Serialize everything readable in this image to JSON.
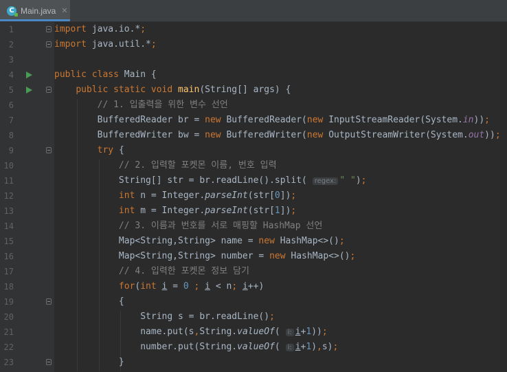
{
  "tab": {
    "filename": "Main.java",
    "icon": "java-class-icon",
    "close": "✕"
  },
  "lines": [
    {
      "n": "1",
      "run": false,
      "fold": true,
      "code": [
        {
          "k": "kw",
          "t": "import"
        },
        {
          "t": " java.io.*"
        },
        {
          "k": "kw",
          "t": ";"
        }
      ]
    },
    {
      "n": "2",
      "run": false,
      "fold": true,
      "code": [
        {
          "k": "kw",
          "t": "import"
        },
        {
          "t": " java.util.*"
        },
        {
          "k": "kw",
          "t": ";"
        }
      ]
    },
    {
      "n": "3",
      "run": false,
      "fold": false,
      "code": []
    },
    {
      "n": "4",
      "run": true,
      "fold": false,
      "code": [
        {
          "k": "kw",
          "t": "public class "
        },
        {
          "t": "Main {"
        }
      ]
    },
    {
      "n": "5",
      "run": true,
      "fold": true,
      "code": [
        {
          "t": "    "
        },
        {
          "k": "kw",
          "t": "public static void "
        },
        {
          "k": "fn",
          "t": "main"
        },
        {
          "t": "(String[] args) {"
        }
      ]
    },
    {
      "n": "6",
      "run": false,
      "fold": false,
      "code": [
        {
          "t": "        "
        },
        {
          "k": "cm",
          "t": "// 1. 입출력을 위한 변수 선언"
        }
      ]
    },
    {
      "n": "7",
      "run": false,
      "fold": false,
      "code": [
        {
          "t": "        BufferedReader br = "
        },
        {
          "k": "kw",
          "t": "new "
        },
        {
          "t": "BufferedReader("
        },
        {
          "k": "kw",
          "t": "new "
        },
        {
          "t": "InputStreamReader(System."
        },
        {
          "k": "fld",
          "t": "in"
        },
        {
          "t": "))"
        },
        {
          "k": "kw",
          "t": ";"
        }
      ]
    },
    {
      "n": "8",
      "run": false,
      "fold": false,
      "code": [
        {
          "t": "        BufferedWriter bw = "
        },
        {
          "k": "kw",
          "t": "new "
        },
        {
          "t": "BufferedWriter("
        },
        {
          "k": "kw",
          "t": "new "
        },
        {
          "t": "OutputStreamWriter(System."
        },
        {
          "k": "fld",
          "t": "out"
        },
        {
          "t": "))"
        },
        {
          "k": "kw",
          "t": ";"
        }
      ]
    },
    {
      "n": "9",
      "run": false,
      "fold": true,
      "code": [
        {
          "t": "        "
        },
        {
          "k": "kw",
          "t": "try "
        },
        {
          "t": "{"
        }
      ]
    },
    {
      "n": "10",
      "run": false,
      "fold": false,
      "code": [
        {
          "t": "            "
        },
        {
          "k": "cm",
          "t": "// 2. 입력할 포켓몬 이름, 번호 입력"
        }
      ]
    },
    {
      "n": "11",
      "run": false,
      "fold": false,
      "code": [
        {
          "t": "            String[] str = br.readLine().split( "
        },
        {
          "k": "hint",
          "t": "regex:"
        },
        {
          "k": "st",
          "t": "\" \""
        },
        {
          "t": ")"
        },
        {
          "k": "kw",
          "t": ";"
        }
      ]
    },
    {
      "n": "12",
      "run": false,
      "fold": false,
      "code": [
        {
          "t": "            "
        },
        {
          "k": "kw",
          "t": "int "
        },
        {
          "t": "n = Integer."
        },
        {
          "k": "it",
          "t": "parseInt"
        },
        {
          "t": "(str["
        },
        {
          "k": "num",
          "t": "0"
        },
        {
          "t": "])"
        },
        {
          "k": "kw",
          "t": ";"
        }
      ]
    },
    {
      "n": "13",
      "run": false,
      "fold": false,
      "code": [
        {
          "t": "            "
        },
        {
          "k": "kw",
          "t": "int "
        },
        {
          "t": "m = Integer."
        },
        {
          "k": "it",
          "t": "parseInt"
        },
        {
          "t": "(str["
        },
        {
          "k": "num",
          "t": "1"
        },
        {
          "t": "])"
        },
        {
          "k": "kw",
          "t": ";"
        }
      ]
    },
    {
      "n": "14",
      "run": false,
      "fold": false,
      "code": [
        {
          "t": "            "
        },
        {
          "k": "cm",
          "t": "// 3. 이름과 번호를 서로 매핑할 HashMap 선언"
        }
      ]
    },
    {
      "n": "15",
      "run": false,
      "fold": false,
      "code": [
        {
          "t": "            Map<String,String> name = "
        },
        {
          "k": "kw",
          "t": "new "
        },
        {
          "t": "HashMap<>()"
        },
        {
          "k": "kw",
          "t": ";"
        }
      ]
    },
    {
      "n": "16",
      "run": false,
      "fold": false,
      "code": [
        {
          "t": "            Map<String,String> number = "
        },
        {
          "k": "kw",
          "t": "new "
        },
        {
          "t": "HashMap<>()"
        },
        {
          "k": "kw",
          "t": ";"
        }
      ]
    },
    {
      "n": "17",
      "run": false,
      "fold": false,
      "code": [
        {
          "t": "            "
        },
        {
          "k": "cm",
          "t": "// 4. 입력한 포켓몬 정보 담기"
        }
      ]
    },
    {
      "n": "18",
      "run": false,
      "fold": false,
      "code": [
        {
          "t": "            "
        },
        {
          "k": "kw",
          "t": "for"
        },
        {
          "t": "("
        },
        {
          "k": "kw",
          "t": "int "
        },
        {
          "k": "und",
          "t": "i"
        },
        {
          "t": " = "
        },
        {
          "k": "num",
          "t": "0 "
        },
        {
          "k": "kw",
          "t": "; "
        },
        {
          "k": "und",
          "t": "i"
        },
        {
          "t": " < n"
        },
        {
          "k": "kw",
          "t": "; "
        },
        {
          "k": "und",
          "t": "i"
        },
        {
          "t": "++)"
        }
      ]
    },
    {
      "n": "19",
      "run": false,
      "fold": true,
      "code": [
        {
          "t": "            {"
        }
      ]
    },
    {
      "n": "20",
      "run": false,
      "fold": false,
      "code": [
        {
          "t": "                String s = br.readLine()"
        },
        {
          "k": "kw",
          "t": ";"
        }
      ]
    },
    {
      "n": "21",
      "run": false,
      "fold": false,
      "code": [
        {
          "t": "                name.put(s"
        },
        {
          "k": "kw",
          "t": ","
        },
        {
          "t": "String."
        },
        {
          "k": "it",
          "t": "valueOf"
        },
        {
          "t": "( "
        },
        {
          "k": "hint",
          "t": "i:"
        },
        {
          "k": "und",
          "t": "i"
        },
        {
          "t": "+"
        },
        {
          "k": "num",
          "t": "1"
        },
        {
          "t": "))"
        },
        {
          "k": "kw",
          "t": ";"
        }
      ]
    },
    {
      "n": "22",
      "run": false,
      "fold": false,
      "code": [
        {
          "t": "                number.put(String."
        },
        {
          "k": "it",
          "t": "valueOf"
        },
        {
          "t": "( "
        },
        {
          "k": "hint",
          "t": "i:"
        },
        {
          "k": "und",
          "t": "i"
        },
        {
          "t": "+"
        },
        {
          "k": "num",
          "t": "1"
        },
        {
          "t": ")"
        },
        {
          "k": "kw",
          "t": ","
        },
        {
          "t": "s)"
        },
        {
          "k": "kw",
          "t": ";"
        }
      ]
    },
    {
      "n": "23",
      "run": false,
      "fold": true,
      "code": [
        {
          "t": "            }"
        }
      ]
    }
  ]
}
